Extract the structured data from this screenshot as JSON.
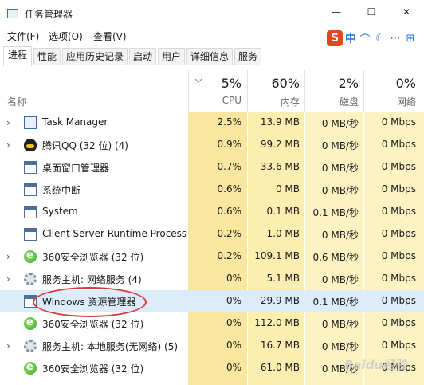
{
  "window": {
    "title": "任务管理器",
    "minimize_glyph": "—",
    "maximize_glyph": "☐",
    "close_glyph": "✕"
  },
  "menu": [
    "文件(F)",
    "选项(O)",
    "查看(V)"
  ],
  "ime": {
    "logo": "S",
    "mode": "中",
    "symbols": [
      "⌒",
      "☾",
      "⋯",
      "⊞"
    ]
  },
  "tabs": [
    "进程",
    "性能",
    "应用历史记录",
    "启动",
    "用户",
    "详细信息",
    "服务"
  ],
  "active_tab": 0,
  "header": {
    "name_label": "名称",
    "columns": [
      {
        "pct": "5%",
        "label": "CPU"
      },
      {
        "pct": "60%",
        "label": "内存"
      },
      {
        "pct": "2%",
        "label": "磁盘"
      },
      {
        "pct": "0%",
        "label": "网络"
      }
    ]
  },
  "processes": [
    {
      "name": "Task Manager",
      "icon": "task-manager-icon",
      "expandable": true,
      "cpu": "2.5%",
      "mem": "13.9 MB",
      "disk": "0 MB/秒",
      "net": "0 Mbps"
    },
    {
      "name": "腾讯QQ (32 位) (4)",
      "icon": "qq-icon",
      "expandable": true,
      "cpu": "0.9%",
      "mem": "99.2 MB",
      "disk": "0 MB/秒",
      "net": "0 Mbps"
    },
    {
      "name": "桌面窗口管理器",
      "icon": "window-icon",
      "expandable": false,
      "cpu": "0.7%",
      "mem": "33.6 MB",
      "disk": "0 MB/秒",
      "net": "0 Mbps"
    },
    {
      "name": "系统中断",
      "icon": "window-icon",
      "expandable": false,
      "cpu": "0.6%",
      "mem": "0 MB",
      "disk": "0 MB/秒",
      "net": "0 Mbps"
    },
    {
      "name": "System",
      "icon": "window-icon",
      "expandable": false,
      "cpu": "0.6%",
      "mem": "0.1 MB",
      "disk": "0.1 MB/秒",
      "net": "0 Mbps"
    },
    {
      "name": "Client Server Runtime Process",
      "icon": "window-icon",
      "expandable": false,
      "cpu": "0.2%",
      "mem": "1.0 MB",
      "disk": "0 MB/秒",
      "net": "0 Mbps"
    },
    {
      "name": "360安全浏览器 (32 位)",
      "icon": "browser-icon",
      "expandable": true,
      "cpu": "0.2%",
      "mem": "109.1 MB",
      "disk": "0.6 MB/秒",
      "net": "0 Mbps"
    },
    {
      "name": "服务主机: 网络服务 (4)",
      "icon": "gear-icon",
      "expandable": true,
      "cpu": "0%",
      "mem": "5.1 MB",
      "disk": "0 MB/秒",
      "net": "0 Mbps"
    },
    {
      "name": "Windows 资源管理器",
      "icon": "explorer-icon",
      "expandable": false,
      "selected": true,
      "cpu": "0%",
      "mem": "29.9 MB",
      "disk": "0.1 MB/秒",
      "net": "0 Mbps"
    },
    {
      "name": "360安全浏览器 (32 位)",
      "icon": "browser-icon",
      "expandable": false,
      "cpu": "0%",
      "mem": "112.0 MB",
      "disk": "0 MB/秒",
      "net": "0 Mbps"
    },
    {
      "name": "服务主机: 本地服务(无网络) (5)",
      "icon": "gear-icon",
      "expandable": true,
      "cpu": "0%",
      "mem": "16.7 MB",
      "disk": "0 MB/秒",
      "net": "0 Mbps"
    },
    {
      "name": "360安全浏览器 (32 位)",
      "icon": "browser-icon",
      "expandable": false,
      "cpu": "0%",
      "mem": "61.0 MB",
      "disk": "0 MB/秒",
      "net": "0 Mbps"
    }
  ],
  "watermark": "Baidu经验",
  "colors": {
    "heat_high": "#f9e79f",
    "heat_low": "#fdf2c2",
    "selected_row": "#dcecfa",
    "annotation": "#d73c3c"
  }
}
